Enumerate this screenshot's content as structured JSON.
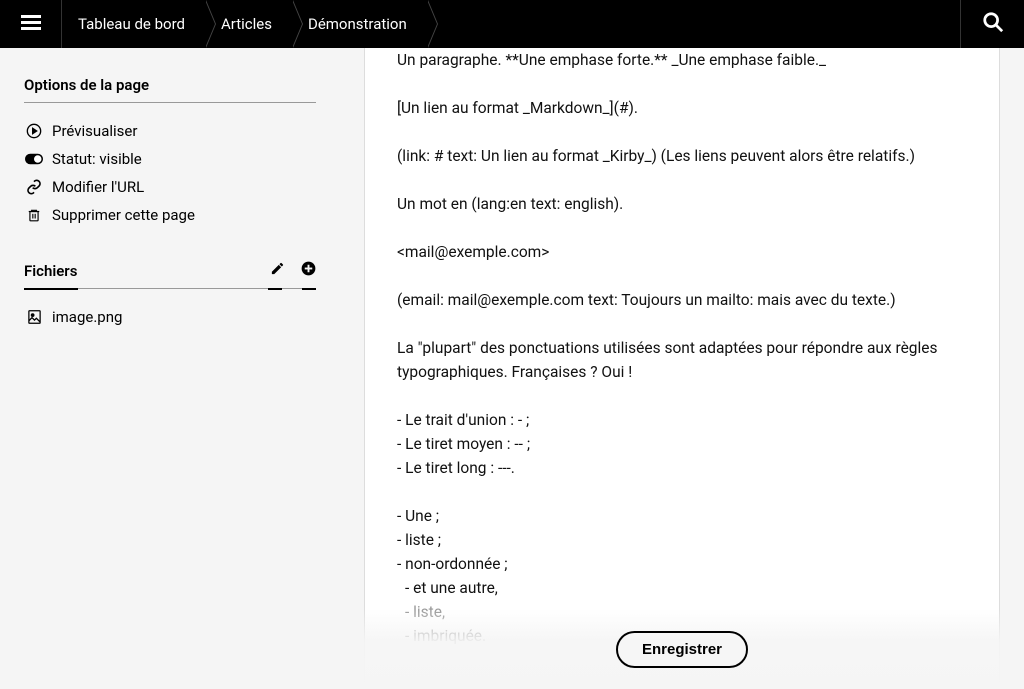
{
  "breadcrumb": {
    "items": [
      {
        "label": "Tableau de bord"
      },
      {
        "label": "Articles"
      },
      {
        "label": "Démonstration"
      }
    ]
  },
  "sidebar": {
    "options_title": "Options de la page",
    "options": [
      {
        "icon": "play-circle",
        "label": "Prévisualiser"
      },
      {
        "icon": "toggle-on",
        "label": "Statut: visible"
      },
      {
        "icon": "link",
        "label": "Modifier l'URL"
      },
      {
        "icon": "trash",
        "label": "Supprimer cette page"
      }
    ],
    "files_title": "Fichiers",
    "files": [
      {
        "icon": "file-image",
        "label": "image.png"
      }
    ]
  },
  "editor": {
    "blocks": [
      {
        "lines": [
          "Un paragraphe. **Une emphase forte.** _Une emphase faible._"
        ]
      },
      {
        "lines": [
          "[Un lien au format _Markdown_](#)."
        ]
      },
      {
        "lines": [
          "(link: # text: Un lien au format _Kirby_) (Les liens peuvent alors être relatifs.)"
        ]
      },
      {
        "lines": [
          "Un mot en (lang:en text: english)."
        ]
      },
      {
        "lines": [
          "<mail@exemple.com>"
        ]
      },
      {
        "lines": [
          "(email: mail@exemple.com text: Toujours un mailto: mais avec du texte.)"
        ]
      },
      {
        "lines": [
          "La \"plupart\" des ponctuations utilisées sont adaptées pour répondre aux règles typographiques. Françaises ? Oui !"
        ]
      },
      {
        "lines": [
          "- Le trait d'union : - ;",
          "- Le tiret moyen : -- ;",
          "- Le tiret long : ---."
        ]
      },
      {
        "lines": [
          "- Une ;",
          "- liste ;",
          "- non-ordonnée ;",
          " - et une autre,",
          " - liste,",
          " - imbriquée."
        ],
        "faded_from": 4
      }
    ],
    "save_label": "Enregistrer"
  },
  "icons": {
    "menu": "menu-icon",
    "search": "search-icon",
    "edit": "edit-icon",
    "add": "add-icon"
  }
}
